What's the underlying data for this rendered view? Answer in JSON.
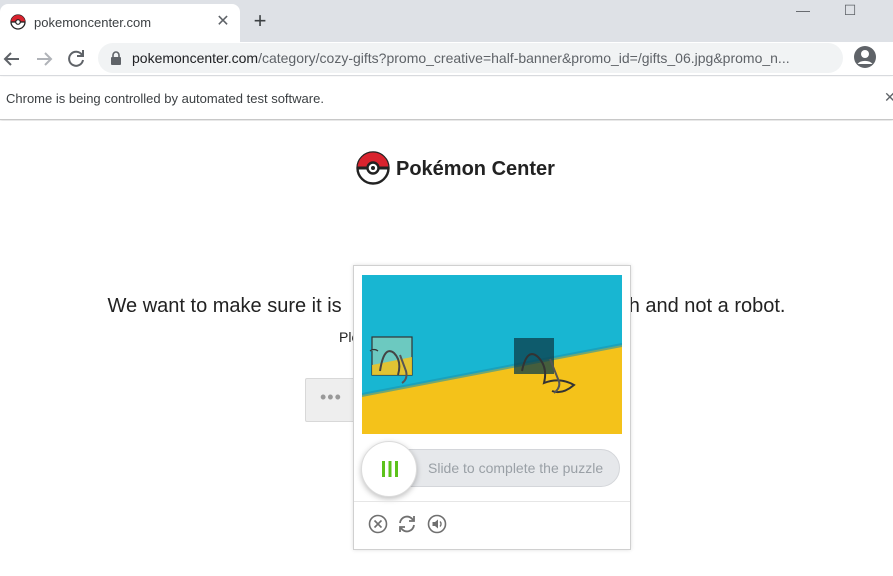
{
  "browser": {
    "tab_title": "pokemoncenter.com",
    "tab_close": "✕",
    "new_tab": "+",
    "window_minimize": "—",
    "window_maximize": "☐",
    "url_host": "pokemoncenter.com",
    "url_path": "/category/cozy-gifts?promo_creative=half-banner&promo_id=/gifts_06.jpg&promo_n...",
    "infobar_text": "Chrome is being controlled by automated test software.",
    "infobar_close": "✕"
  },
  "page": {
    "logo_text": "Pokémon Center",
    "verify_left": "We want to make sure it is",
    "verify_right": "h and not a robot.",
    "verify_sub": "Ple",
    "dots": "•••"
  },
  "captcha": {
    "slider_hint": "Slide to complete the puzzle",
    "controls": [
      "close-icon",
      "refresh-icon",
      "audio-icon"
    ],
    "colors": {
      "sky": "#18b6d2",
      "sand": "#f4c21a",
      "knob_bars": "#5cc21a"
    }
  }
}
